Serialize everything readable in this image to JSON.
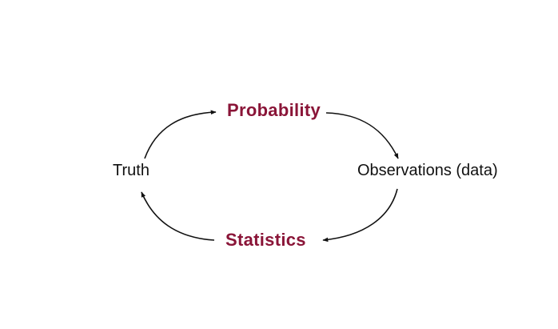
{
  "diagram": {
    "nodes": {
      "truth": "Truth",
      "observations": "Observations (data)"
    },
    "edges": {
      "top": "Probability",
      "bottom": "Statistics"
    }
  },
  "colors": {
    "accent": "#8a1538",
    "text": "#111111",
    "arrow": "#111111",
    "background": "#ffffff"
  }
}
